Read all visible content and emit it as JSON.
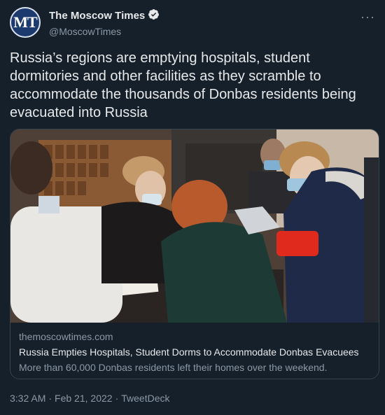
{
  "author": {
    "avatar_text": "MT",
    "display_name": "The Moscow Times",
    "handle": "@MoscowTimes",
    "verified": true
  },
  "menu": {
    "more_label": "···"
  },
  "tweet": {
    "text": "Russia’s regions are emptying hospitals, student dormitories and other facilities as they scramble to accommodate the thousands of Donbas residents being evacuated into Russia"
  },
  "card": {
    "domain": "themoscowtimes.com",
    "title": "Russia Empties Hospitals, Student Dorms to Accommodate Donbas Evacuees",
    "description": "More than 60,000 Donbas residents left their homes over the weekend."
  },
  "meta": {
    "time": "3:32 AM",
    "separator1": "·",
    "date": "Feb 21, 2022",
    "separator2": "·",
    "source": "TweetDeck"
  },
  "colors": {
    "background": "#15202b",
    "text_primary": "#e7e9ea",
    "text_secondary": "#8b98a5",
    "verified": "#1d9bf0",
    "border": "#38444d"
  }
}
